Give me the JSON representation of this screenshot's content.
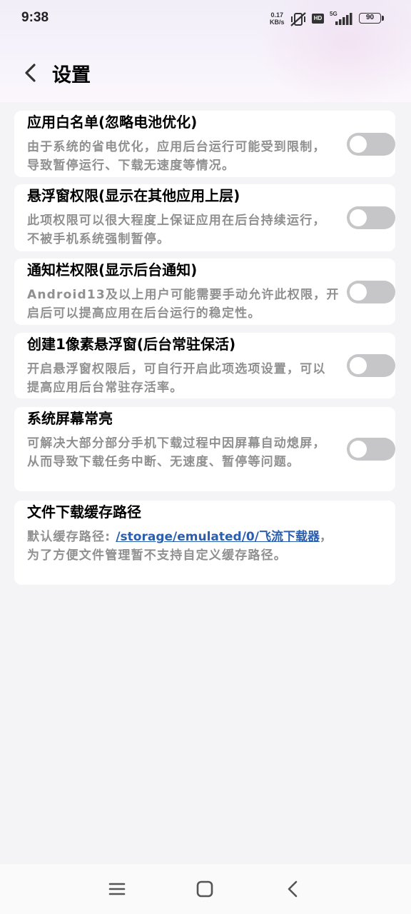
{
  "status_bar": {
    "time": "9:38",
    "net_speed_value": "0.17",
    "net_speed_unit": "KB/s",
    "hd_label": "HD",
    "network_type": "5G",
    "battery": "90"
  },
  "header": {
    "title": "设置"
  },
  "settings": [
    {
      "title": "应用白名单(忽略电池优化)",
      "description": "由于系统的省电优化，应用后台运行可能受到限制，导致暂停运行、下载无速度等情况。"
    },
    {
      "title": "悬浮窗权限(显示在其他应用上层)",
      "description": "此项权限可以很大程度上保证应用在后台持续运行，不被手机系统强制暂停。"
    },
    {
      "title": "通知栏权限(显示后台通知)",
      "description": "Android13及以上用户可能需要手动允许此权限，开启后可以提高应用在后台运行的稳定性。"
    },
    {
      "title": "创建1像素悬浮窗(后台常驻保活)",
      "description": "开启悬浮窗权限后，可自行开启此项选项设置，可以提高应用后台常驻存活率。"
    },
    {
      "title": "系统屏幕常亮",
      "description": "可解决大部分部分手机下载过程中因屏幕自动熄屏，从而导致下载任务中断、无速度、暂停等问题。"
    }
  ],
  "cache_path": {
    "title": "文件下载缓存路径",
    "prefix": "默认缓存路径: ",
    "path": "/storage/emulated/0/飞流下载器",
    "suffix": "，为了方便文件管理暂不支持自定义缓存路径。"
  },
  "icons": {
    "back": "chevron-left-icon",
    "menu": "menu-icon",
    "home": "home-icon",
    "nav_back": "nav-back-icon"
  },
  "colors": {
    "toggle_off": "#c6c6c8",
    "link": "#2a5fb0",
    "description": "#909090"
  }
}
